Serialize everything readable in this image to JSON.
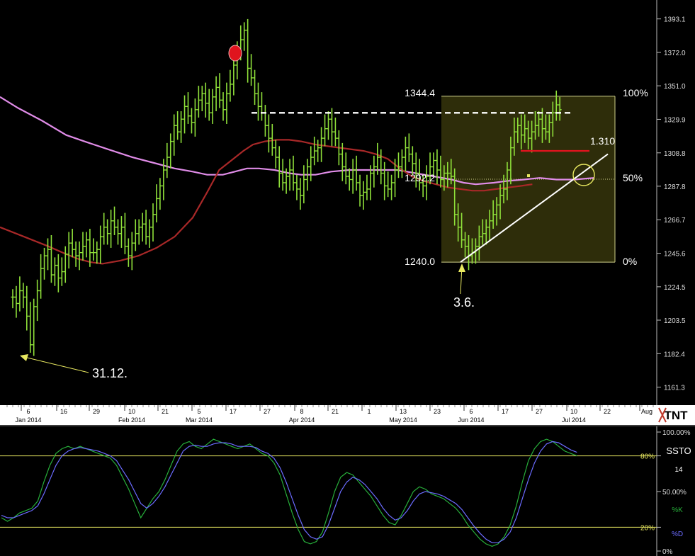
{
  "chart_data": [
    {
      "type": "ohlc",
      "subtype": "price",
      "ylim": [
        1150,
        1405
      ],
      "y_ticks": [
        "1393.1",
        "1372.0",
        "1351.0",
        "1329.9",
        "1308.8",
        "1287.8",
        "1266.7",
        "1245.6",
        "1224.5",
        "1203.5",
        "1182.4",
        "1161.3"
      ],
      "x_ticks": [
        {
          "label": "6",
          "sub": "Jan 2014"
        },
        {
          "label": "16",
          "sub": ""
        },
        {
          "label": "29",
          "sub": ""
        },
        {
          "label": "10",
          "sub": "Feb 2014"
        },
        {
          "label": "21",
          "sub": ""
        },
        {
          "label": "5",
          "sub": "Mar 2014"
        },
        {
          "label": "17",
          "sub": ""
        },
        {
          "label": "27",
          "sub": ""
        },
        {
          "label": "8",
          "sub": "Apr 2014"
        },
        {
          "label": "21",
          "sub": ""
        },
        {
          "label": "1",
          "sub": ""
        },
        {
          "label": "13",
          "sub": "May 2014"
        },
        {
          "label": "23",
          "sub": ""
        },
        {
          "label": "6",
          "sub": "Jun 2014"
        },
        {
          "label": "17",
          "sub": ""
        },
        {
          "label": "27",
          "sub": ""
        },
        {
          "label": "10",
          "sub": "Jul 2014"
        },
        {
          "label": "22",
          "sub": ""
        },
        {
          "label": "Aug",
          "sub": ""
        }
      ],
      "bars_close": [
        1218,
        1214,
        1222,
        1218,
        1206,
        1188,
        1212,
        1222,
        1236,
        1244,
        1248,
        1232,
        1238,
        1230,
        1234,
        1245,
        1252,
        1248,
        1244,
        1246,
        1250,
        1254,
        1246,
        1246,
        1248,
        1256,
        1262,
        1258,
        1266,
        1262,
        1258,
        1262,
        1250,
        1244,
        1252,
        1258,
        1262,
        1264,
        1256,
        1262,
        1270,
        1280,
        1288,
        1298,
        1306,
        1316,
        1326,
        1322,
        1330,
        1338,
        1332,
        1328,
        1336,
        1342,
        1346,
        1340,
        1334,
        1344,
        1350,
        1342,
        1336,
        1346,
        1352,
        1364,
        1372,
        1380,
        1386,
        1362,
        1356,
        1346,
        1338,
        1334,
        1326,
        1318,
        1312,
        1306,
        1296,
        1290,
        1294,
        1298,
        1290,
        1286,
        1282,
        1292,
        1300,
        1306,
        1310,
        1312,
        1318,
        1324,
        1330,
        1322,
        1318,
        1308,
        1300,
        1294,
        1292,
        1298,
        1290,
        1282,
        1284,
        1286,
        1296,
        1300,
        1306,
        1296,
        1288,
        1286,
        1290,
        1298,
        1300,
        1306,
        1312,
        1308,
        1302,
        1296,
        1290,
        1288,
        1294,
        1300,
        1304,
        1298,
        1292,
        1296,
        1296,
        1294,
        1270,
        1262,
        1254,
        1250,
        1244,
        1246,
        1250,
        1256,
        1258,
        1262,
        1266,
        1270,
        1276,
        1282,
        1286,
        1298,
        1312,
        1322,
        1326,
        1320,
        1324,
        1318,
        1322,
        1326,
        1330,
        1324,
        1322,
        1328,
        1334,
        1339,
        1336
      ],
      "ma_long": [
        [
          0,
          1344
        ],
        [
          15,
          1337
        ],
        [
          35,
          1329
        ],
        [
          55,
          1320
        ],
        [
          70,
          1316
        ],
        [
          90,
          1311
        ],
        [
          110,
          1306
        ],
        [
          130,
          1302
        ],
        [
          145,
          1299
        ],
        [
          160,
          1297
        ],
        [
          172,
          1295
        ],
        [
          185,
          1295
        ],
        [
          195,
          1297
        ],
        [
          205,
          1299
        ],
        [
          215,
          1299
        ],
        [
          228,
          1298
        ],
        [
          240,
          1296
        ],
        [
          250,
          1295
        ],
        [
          262,
          1295
        ],
        [
          275,
          1297
        ],
        [
          290,
          1298
        ],
        [
          310,
          1298
        ],
        [
          330,
          1298
        ],
        [
          345,
          1296
        ],
        [
          360,
          1294
        ],
        [
          375,
          1292
        ],
        [
          385,
          1290
        ],
        [
          395,
          1289
        ],
        [
          410,
          1290
        ],
        [
          420,
          1291
        ],
        [
          435,
          1292
        ],
        [
          448,
          1293
        ],
        [
          462,
          1292
        ],
        [
          477,
          1292
        ],
        [
          493,
          1293
        ]
      ],
      "ma_short": [
        [
          0,
          1262
        ],
        [
          20,
          1256
        ],
        [
          40,
          1250
        ],
        [
          55,
          1245
        ],
        [
          65,
          1242
        ],
        [
          75,
          1240
        ],
        [
          85,
          1239
        ],
        [
          100,
          1241
        ],
        [
          115,
          1244
        ],
        [
          130,
          1249
        ],
        [
          145,
          1256
        ],
        [
          160,
          1268
        ],
        [
          172,
          1284
        ],
        [
          182,
          1298
        ],
        [
          192,
          1304
        ],
        [
          202,
          1310
        ],
        [
          210,
          1314
        ],
        [
          220,
          1316
        ],
        [
          230,
          1317
        ],
        [
          240,
          1317
        ],
        [
          250,
          1316
        ],
        [
          262,
          1314
        ],
        [
          272,
          1313
        ],
        [
          282,
          1312
        ],
        [
          292,
          1311
        ],
        [
          302,
          1310
        ],
        [
          312,
          1308
        ],
        [
          322,
          1305
        ],
        [
          332,
          1299
        ],
        [
          342,
          1294
        ],
        [
          352,
          1291
        ],
        [
          362,
          1289
        ],
        [
          372,
          1287
        ],
        [
          382,
          1286
        ],
        [
          392,
          1285
        ],
        [
          402,
          1285
        ],
        [
          412,
          1286
        ],
        [
          422,
          1287
        ],
        [
          433,
          1288
        ],
        [
          442,
          1289
        ]
      ],
      "fib": {
        "high": "1344.4",
        "mid": "1292.2",
        "low": "1240.0",
        "pct_high": "100%",
        "pct_mid": "50%",
        "pct_low": "0%",
        "high_value": 1344.4,
        "mid_value": 1292.2,
        "low_value": 1240.0
      },
      "resistance_label": "1.310",
      "resistance_value": 1310,
      "prior_high_value": 1334,
      "annotations": [
        {
          "text": "31.12."
        },
        {
          "text": "3.6."
        }
      ],
      "logo": "TNT"
    },
    {
      "type": "line",
      "subtype": "stochastic",
      "title": "SSTO",
      "param": "14",
      "ylim": [
        0,
        100
      ],
      "y_ticks": [
        "100.00%",
        "80%",
        "50.00%",
        "20%",
        "0%"
      ],
      "legend": [
        "%K",
        "%D"
      ],
      "series": [
        {
          "name": "%K",
          "values": [
            28,
            25,
            28,
            32,
            34,
            36,
            42,
            58,
            72,
            82,
            86,
            88,
            86,
            88,
            86,
            84,
            82,
            80,
            78,
            72,
            62,
            52,
            40,
            28,
            36,
            44,
            50,
            60,
            72,
            84,
            90,
            92,
            88,
            86,
            90,
            94,
            92,
            90,
            88,
            86,
            88,
            90,
            86,
            82,
            80,
            74,
            64,
            48,
            32,
            18,
            8,
            6,
            8,
            16,
            32,
            50,
            62,
            66,
            64,
            58,
            52,
            46,
            38,
            30,
            24,
            22,
            30,
            40,
            50,
            54,
            52,
            48,
            46,
            44,
            40,
            36,
            30,
            22,
            16,
            10,
            6,
            4,
            6,
            12,
            22,
            38,
            58,
            76,
            86,
            92,
            94,
            92,
            88,
            84,
            82,
            80
          ]
        },
        {
          "name": "%D",
          "values": [
            30,
            28,
            28,
            30,
            32,
            34,
            38,
            48,
            60,
            72,
            80,
            84,
            86,
            87,
            86,
            85,
            84,
            82,
            80,
            76,
            68,
            60,
            50,
            40,
            36,
            40,
            46,
            54,
            64,
            74,
            84,
            88,
            89,
            88,
            88,
            90,
            91,
            91,
            90,
            88,
            88,
            88,
            87,
            84,
            82,
            78,
            70,
            58,
            44,
            30,
            18,
            12,
            10,
            12,
            22,
            36,
            50,
            58,
            62,
            60,
            56,
            50,
            44,
            36,
            30,
            26,
            28,
            34,
            42,
            48,
            50,
            49,
            48,
            46,
            43,
            40,
            35,
            28,
            21,
            15,
            10,
            7,
            7,
            10,
            16,
            28,
            44,
            60,
            74,
            84,
            90,
            92,
            91,
            88,
            85,
            83
          ]
        }
      ]
    }
  ]
}
